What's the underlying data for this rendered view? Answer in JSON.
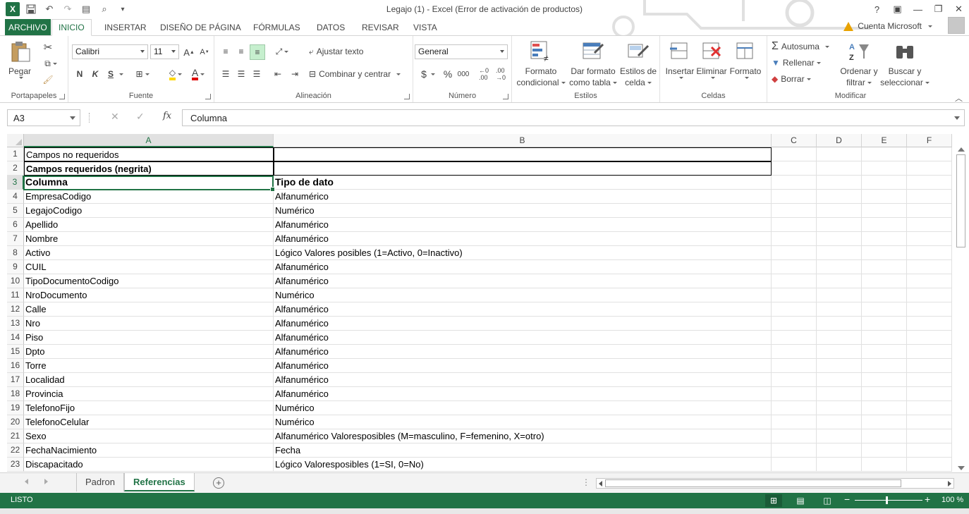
{
  "titlebar": {
    "title": "Legajo (1) - Excel (Error de activación de productos)",
    "help": "?"
  },
  "tabs": [
    "ARCHIVO",
    "INICIO",
    "INSERTAR",
    "DISEÑO DE PÁGINA",
    "FÓRMULAS",
    "DATOS",
    "REVISAR",
    "VISTA"
  ],
  "account": {
    "label": "Cuenta Microsoft"
  },
  "ribbon": {
    "portapapeles": {
      "label": "Portapapeles",
      "paste": "Pegar"
    },
    "fuente": {
      "label": "Fuente",
      "font_name": "Calibri",
      "font_size": "11",
      "bold": "N",
      "italic": "K",
      "underline": "S"
    },
    "alineacion": {
      "label": "Alineación",
      "wrap": "Ajustar texto",
      "merge": "Combinar y centrar"
    },
    "numero": {
      "label": "Número",
      "format": "General",
      "currency": "$",
      "percent": "%",
      "thousands": "000"
    },
    "estilos": {
      "label": "Estilos",
      "cond_format_1": "Formato",
      "cond_format_2": "condicional",
      "table_format_1": "Dar formato",
      "table_format_2": "como tabla",
      "cell_styles_1": "Estilos de",
      "cell_styles_2": "celda"
    },
    "celdas": {
      "label": "Celdas",
      "insert": "Insertar",
      "delete": "Eliminar",
      "format": "Formato"
    },
    "modificar": {
      "label": "Modificar",
      "autosum": "Autosuma",
      "fill": "Rellenar",
      "clear": "Borrar",
      "sort_1": "Ordenar y",
      "sort_2": "filtrar",
      "find_1": "Buscar y",
      "find_2": "seleccionar"
    }
  },
  "formula_bar": {
    "name_box": "A3",
    "fx": "fx",
    "value": "Columna"
  },
  "columns": [
    "A",
    "B",
    "C",
    "D",
    "E",
    "F"
  ],
  "rows": [
    {
      "num": "1",
      "a": "Campos no requeridos",
      "b": ""
    },
    {
      "num": "2",
      "a": "Campos requeridos (negrita)",
      "b": ""
    },
    {
      "num": "3",
      "a": "Columna",
      "b": "Tipo de dato"
    },
    {
      "num": "4",
      "a": "EmpresaCodigo",
      "b": "Alfanumérico"
    },
    {
      "num": "5",
      "a": "LegajoCodigo",
      "b": "Numérico"
    },
    {
      "num": "6",
      "a": "Apellido",
      "b": "Alfanumérico"
    },
    {
      "num": "7",
      "a": "Nombre",
      "b": "Alfanumérico"
    },
    {
      "num": "8",
      "a": "Activo",
      "b": "Lógico Valores posibles (1=Activo, 0=Inactivo)"
    },
    {
      "num": "9",
      "a": "CUIL",
      "b": "Alfanumérico"
    },
    {
      "num": "10",
      "a": "TipoDocumentoCodigo",
      "b": "Alfanumérico"
    },
    {
      "num": "11",
      "a": "NroDocumento",
      "b": "Numérico"
    },
    {
      "num": "12",
      "a": "Calle",
      "b": "Alfanumérico"
    },
    {
      "num": "13",
      "a": "Nro",
      "b": "Alfanumérico"
    },
    {
      "num": "14",
      "a": "Piso",
      "b": "Alfanumérico"
    },
    {
      "num": "15",
      "a": "Dpto",
      "b": "Alfanumérico"
    },
    {
      "num": "16",
      "a": "Torre",
      "b": "Alfanumérico"
    },
    {
      "num": "17",
      "a": "Localidad",
      "b": "Alfanumérico"
    },
    {
      "num": "18",
      "a": "Provincia",
      "b": "Alfanumérico"
    },
    {
      "num": "19",
      "a": "TelefonoFijo",
      "b": "Numérico"
    },
    {
      "num": "20",
      "a": "TelefonoCelular",
      "b": "Numérico"
    },
    {
      "num": "21",
      "a": "Sexo",
      "b": "Alfanumérico Valoresposibles (M=masculino, F=femenino, X=otro)"
    },
    {
      "num": "22",
      "a": "FechaNacimiento",
      "b": "Fecha"
    },
    {
      "num": "23",
      "a": "Discapacitado",
      "b": "Lógico Valoresposibles (1=SI, 0=No)"
    }
  ],
  "sheets": [
    "Padron",
    "Referencias"
  ],
  "active_sheet": "Referencias",
  "status": {
    "text": "LISTO",
    "zoom": "100 %"
  },
  "colors": {
    "accent": "#217346"
  }
}
